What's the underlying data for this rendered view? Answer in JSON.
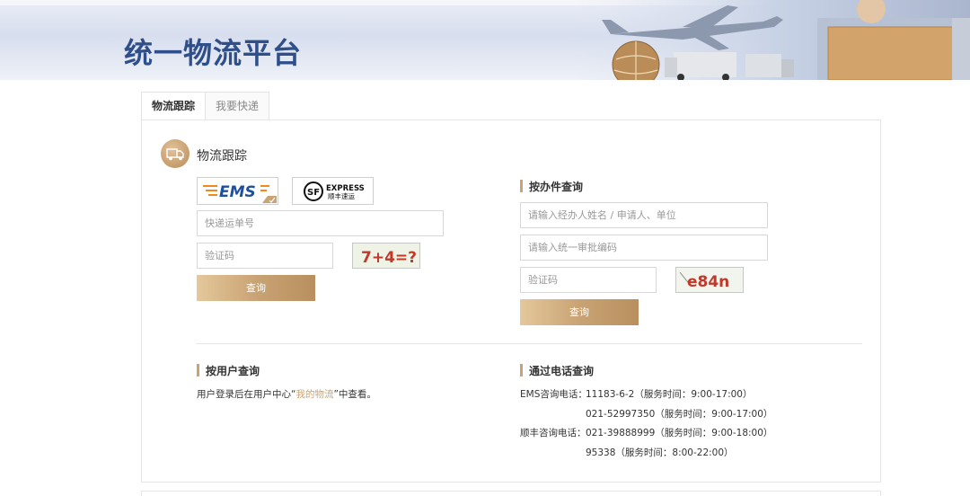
{
  "header": {
    "title": "统一物流平台"
  },
  "tabs": [
    {
      "label": "物流跟踪"
    },
    {
      "label": "我要快递"
    }
  ],
  "tracking": {
    "section_title": "物流跟踪",
    "carriers": [
      "EMS",
      "SF EXPRESS 顺丰速运"
    ],
    "tracking_placeholder": "快递运单号",
    "captcha_placeholder": "验证码",
    "captcha_text": "7+4=?",
    "query_label": "查询"
  },
  "by_office": {
    "heading": "按办件查询",
    "applicant_placeholder": "请输入经办人姓名 / 申请人、单位",
    "approval_placeholder": "请输入统一审批编码",
    "captcha_placeholder": "验证码",
    "captcha_text": "e84n",
    "query_label": "查询"
  },
  "by_user": {
    "heading": "按用户查询",
    "text_before": "用户登录后在用户中心“",
    "link": "我的物流",
    "text_after": "”中查看。"
  },
  "by_phone": {
    "heading": "通过电话查询",
    "lines": [
      {
        "label": "EMS咨询电话：",
        "value": "11183-6-2（服务时间：9:00-17:00）"
      },
      {
        "label": "",
        "value": "021-52997350（服务时间：9:00-17:00）"
      },
      {
        "label": "顺丰咨询电话：",
        "value": "021-39888999（服务时间：9:00-18:00）"
      },
      {
        "label": "",
        "value": "95338（服务时间：8:00-22:00）"
      }
    ]
  },
  "colors": {
    "accent_gold": "#c9a374",
    "title_blue": "#2f4f8a",
    "ems_orange": "#f08a1c",
    "ems_blue": "#1f4fa0"
  }
}
